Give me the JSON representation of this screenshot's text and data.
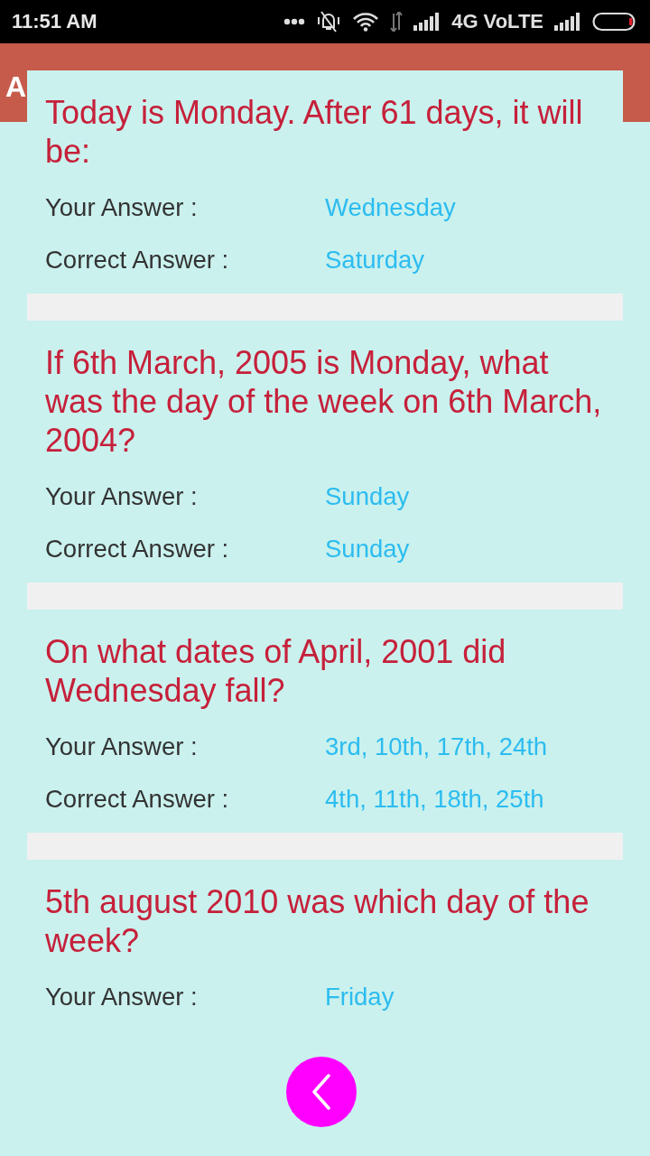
{
  "status_bar": {
    "time": "11:51 AM",
    "network": "4G VoLTE"
  },
  "app_bar": {
    "title": "A"
  },
  "dialog": {
    "results": [
      {
        "question": "Today is Monday. After 61 days, it will be:",
        "answers": [
          {
            "label": "Your Answer :",
            "value": "Wednesday"
          },
          {
            "label": "Correct Answer :",
            "value": "Saturday"
          }
        ]
      },
      {
        "question": "If 6th March, 2005 is Monday, what was the day of the week on 6th March, 2004?",
        "answers": [
          {
            "label": "Your Answer :",
            "value": "Sunday"
          },
          {
            "label": "Correct Answer :",
            "value": "Sunday"
          }
        ]
      },
      {
        "question": "On what dates of April, 2001 did Wednesday fall?",
        "answers": [
          {
            "label": "Your Answer :",
            "value": "3rd, 10th, 17th, 24th"
          },
          {
            "label": "Correct Answer :",
            "value": "4th, 11th, 18th, 25th"
          }
        ]
      },
      {
        "question": "5th august 2010 was which day of the week?",
        "answers": [
          {
            "label": "Your Answer :",
            "value": "Friday"
          }
        ]
      }
    ]
  }
}
